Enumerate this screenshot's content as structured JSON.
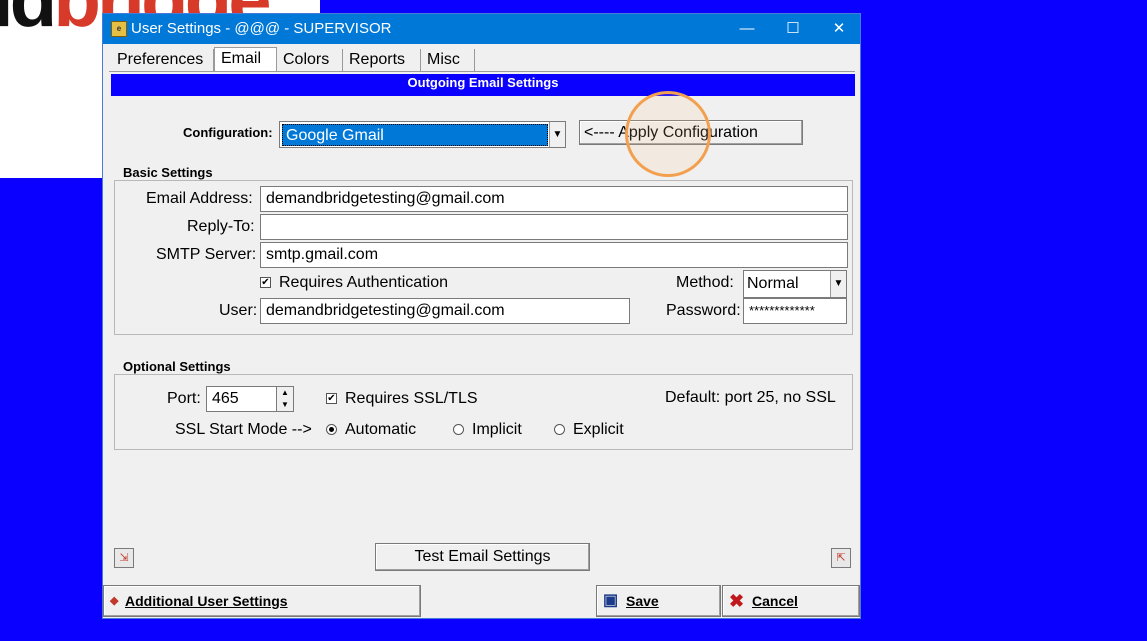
{
  "window": {
    "title": "User Settings - @@@ - SUPERVISOR",
    "icon_label": "e",
    "minimize_glyph": "—",
    "maximize_glyph": "☐",
    "close_glyph": "✕"
  },
  "tabs": [
    {
      "label": "Preferences"
    },
    {
      "label": "Email"
    },
    {
      "label": "Colors"
    },
    {
      "label": "Reports"
    },
    {
      "label": "Misc"
    }
  ],
  "banner": "Outgoing Email Settings",
  "configuration": {
    "label": "Configuration:",
    "selected": "Google Gmail",
    "apply_button": "<---- Apply Configuration"
  },
  "basic": {
    "title": "Basic Settings",
    "email_label": "Email Address:",
    "email_value": "demandbridgetesting@gmail.com",
    "reply_label": "Reply-To:",
    "reply_value": "",
    "smtp_label": "SMTP Server:",
    "smtp_value": "smtp.gmail.com",
    "auth_label": "Requires Authentication",
    "auth_checked": true,
    "method_label": "Method:",
    "method_value": "Normal",
    "user_label": "User:",
    "user_value": "demandbridgetesting@gmail.com",
    "password_label": "Password:",
    "password_value": "*************"
  },
  "optional": {
    "title": "Optional Settings",
    "port_label": "Port:",
    "port_value": "465",
    "ssl_label": "Requires SSL/TLS",
    "ssl_checked": true,
    "default_note": "Default: port 25, no SSL",
    "start_mode_label": "SSL Start Mode -->",
    "modes": [
      "Automatic",
      "Implicit",
      "Explicit"
    ],
    "selected_mode": "Automatic"
  },
  "test_button": "Test Email Settings",
  "footer": {
    "additional": "Additional User Settings",
    "save": "Save",
    "cancel": "Cancel"
  },
  "colors": {
    "titlebar": "#0078d7",
    "banner": "#0a00ff",
    "highlight_circle": "#f2a050"
  }
}
